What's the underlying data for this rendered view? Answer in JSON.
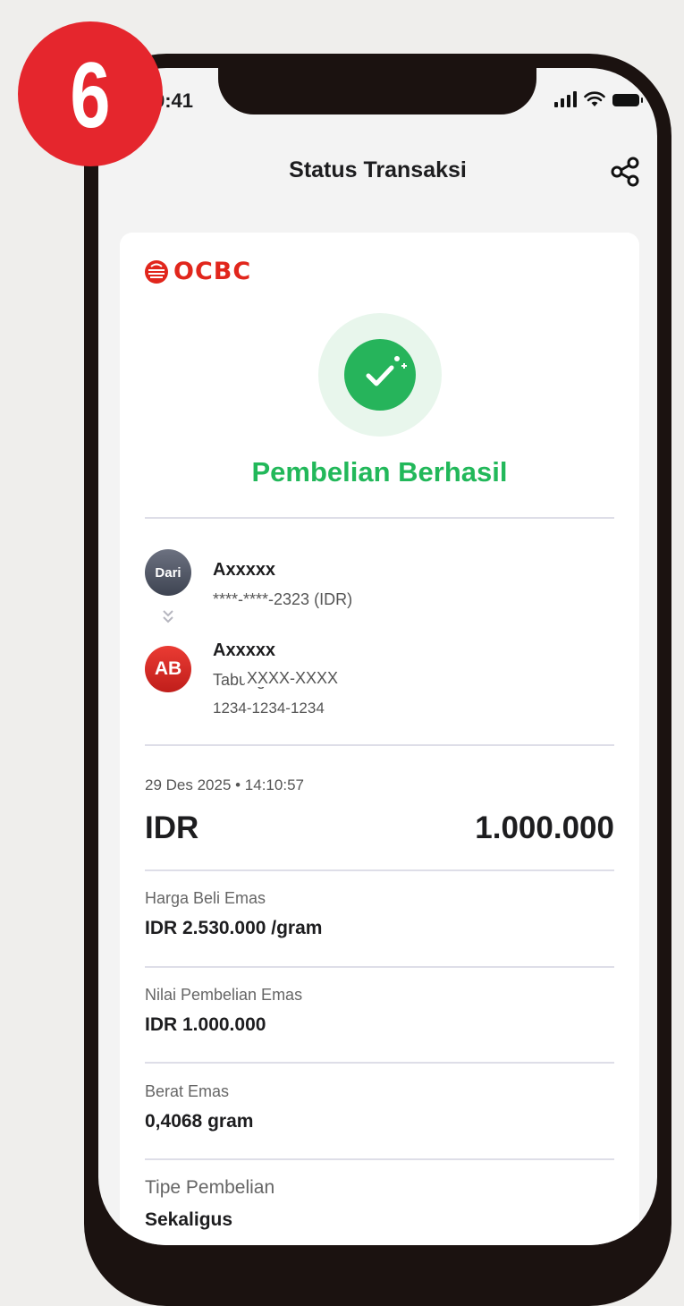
{
  "step_badge": {
    "number": "6"
  },
  "status_bar": {
    "time": "9:41"
  },
  "header": {
    "title": "Status Transaksi",
    "share_icon": "share-icon"
  },
  "brand": {
    "name": "OCBC",
    "color": "#e1261c"
  },
  "result": {
    "title": "Pembelian Berhasil",
    "color": "#22b85a",
    "icon": "check-sparkle-icon"
  },
  "from": {
    "avatar_label": "Dari",
    "name": "Axxxxx",
    "account": "****-****-2323 (IDR)"
  },
  "to": {
    "avatar_initials": "AB",
    "name": "Axxxxx",
    "account_type": "Tabungan Emas",
    "account_mask": "XXXX-XXXX",
    "account_number": "1234-1234-1234"
  },
  "transaction": {
    "datetime": "29 Des 2025 • 14:10:57",
    "currency": "IDR",
    "amount": "1.000.000"
  },
  "details": [
    {
      "label": "Harga Beli Emas",
      "value": "IDR 2.530.000 /gram"
    },
    {
      "label": "Nilai Pembelian Emas",
      "value": "IDR 1.000.000"
    },
    {
      "label": "Berat Emas",
      "value": "0,4068 gram"
    },
    {
      "label": "Tipe Pembelian",
      "value": "Sekaligus"
    }
  ]
}
